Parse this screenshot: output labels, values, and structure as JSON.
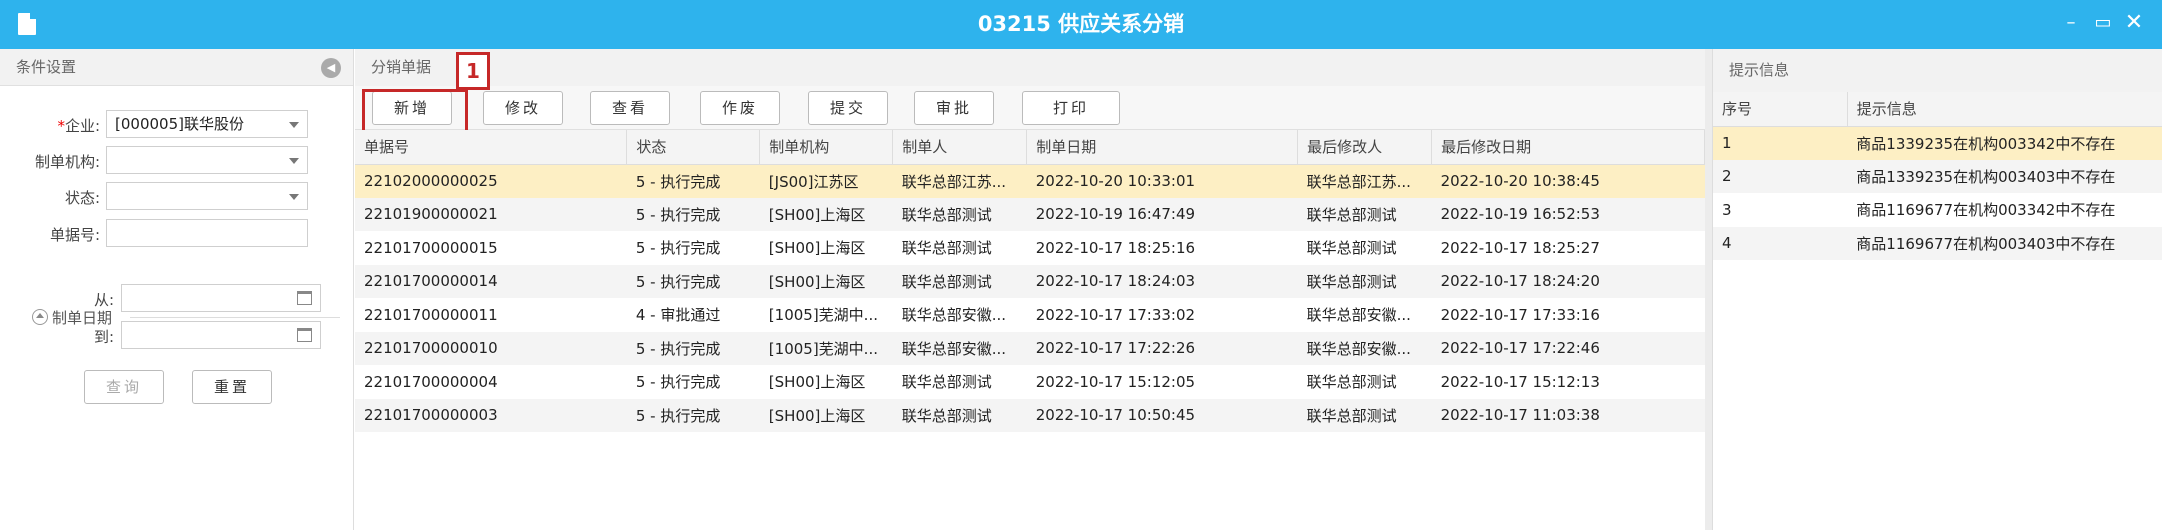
{
  "window": {
    "title": "03215 供应关系分销",
    "min": "–",
    "restore": "▭",
    "close": "✕"
  },
  "left": {
    "header": "条件设置",
    "labels": {
      "company_req": "*",
      "company": "企业:",
      "org": "制单机构:",
      "status": "状态:",
      "doc_no": "单据号:",
      "date_group": "制单日期",
      "from": "从:",
      "to": "到:"
    },
    "values": {
      "company": "[000005]联华股份",
      "org": "",
      "status": "",
      "doc_no": "",
      "from": "",
      "to": ""
    },
    "buttons": {
      "query": "查询",
      "reset": "重置"
    }
  },
  "center": {
    "header": "分销单据",
    "toolbar": [
      "新增",
      "修改",
      "查看",
      "作废",
      "提交",
      "审批",
      "打印"
    ],
    "badge": "1",
    "columns": [
      "单据号",
      "状态",
      "制单机构",
      "制单人",
      "制单日期",
      "最后修改人",
      "最后修改日期"
    ],
    "rows": [
      [
        "22102000000025",
        "5 - 执行完成",
        "[JS00]江苏区",
        "联华总部江苏...",
        "2022-10-20 10:33:01",
        "联华总部江苏...",
        "2022-10-20 10:38:45"
      ],
      [
        "22101900000021",
        "5 - 执行完成",
        "[SH00]上海区",
        "联华总部测试",
        "2022-10-19 16:47:49",
        "联华总部测试",
        "2022-10-19 16:52:53"
      ],
      [
        "22101700000015",
        "5 - 执行完成",
        "[SH00]上海区",
        "联华总部测试",
        "2022-10-17 18:25:16",
        "联华总部测试",
        "2022-10-17 18:25:27"
      ],
      [
        "22101700000014",
        "5 - 执行完成",
        "[SH00]上海区",
        "联华总部测试",
        "2022-10-17 18:24:03",
        "联华总部测试",
        "2022-10-17 18:24:20"
      ],
      [
        "22101700000011",
        "4 - 审批通过",
        "[1005]芜湖中...",
        "联华总部安徽...",
        "2022-10-17 17:33:02",
        "联华总部安徽...",
        "2022-10-17 17:33:16"
      ],
      [
        "22101700000010",
        "5 - 执行完成",
        "[1005]芜湖中...",
        "联华总部安徽...",
        "2022-10-17 17:22:26",
        "联华总部安徽...",
        "2022-10-17 17:22:46"
      ],
      [
        "22101700000004",
        "5 - 执行完成",
        "[SH00]上海区",
        "联华总部测试",
        "2022-10-17 15:12:05",
        "联华总部测试",
        "2022-10-17 15:12:13"
      ],
      [
        "22101700000003",
        "5 - 执行完成",
        "[SH00]上海区",
        "联华总部测试",
        "2022-10-17 10:50:45",
        "联华总部测试",
        "2022-10-17 11:03:38"
      ]
    ]
  },
  "right": {
    "header": "提示信息",
    "columns": [
      "序号",
      "提示信息"
    ],
    "rows": [
      [
        "1",
        "商品1339235在机构003342中不存在"
      ],
      [
        "2",
        "商品1339235在机构003403中不存在"
      ],
      [
        "3",
        "商品1169677在机构003342中不存在"
      ],
      [
        "4",
        "商品1169677在机构003403中不存在"
      ]
    ]
  }
}
